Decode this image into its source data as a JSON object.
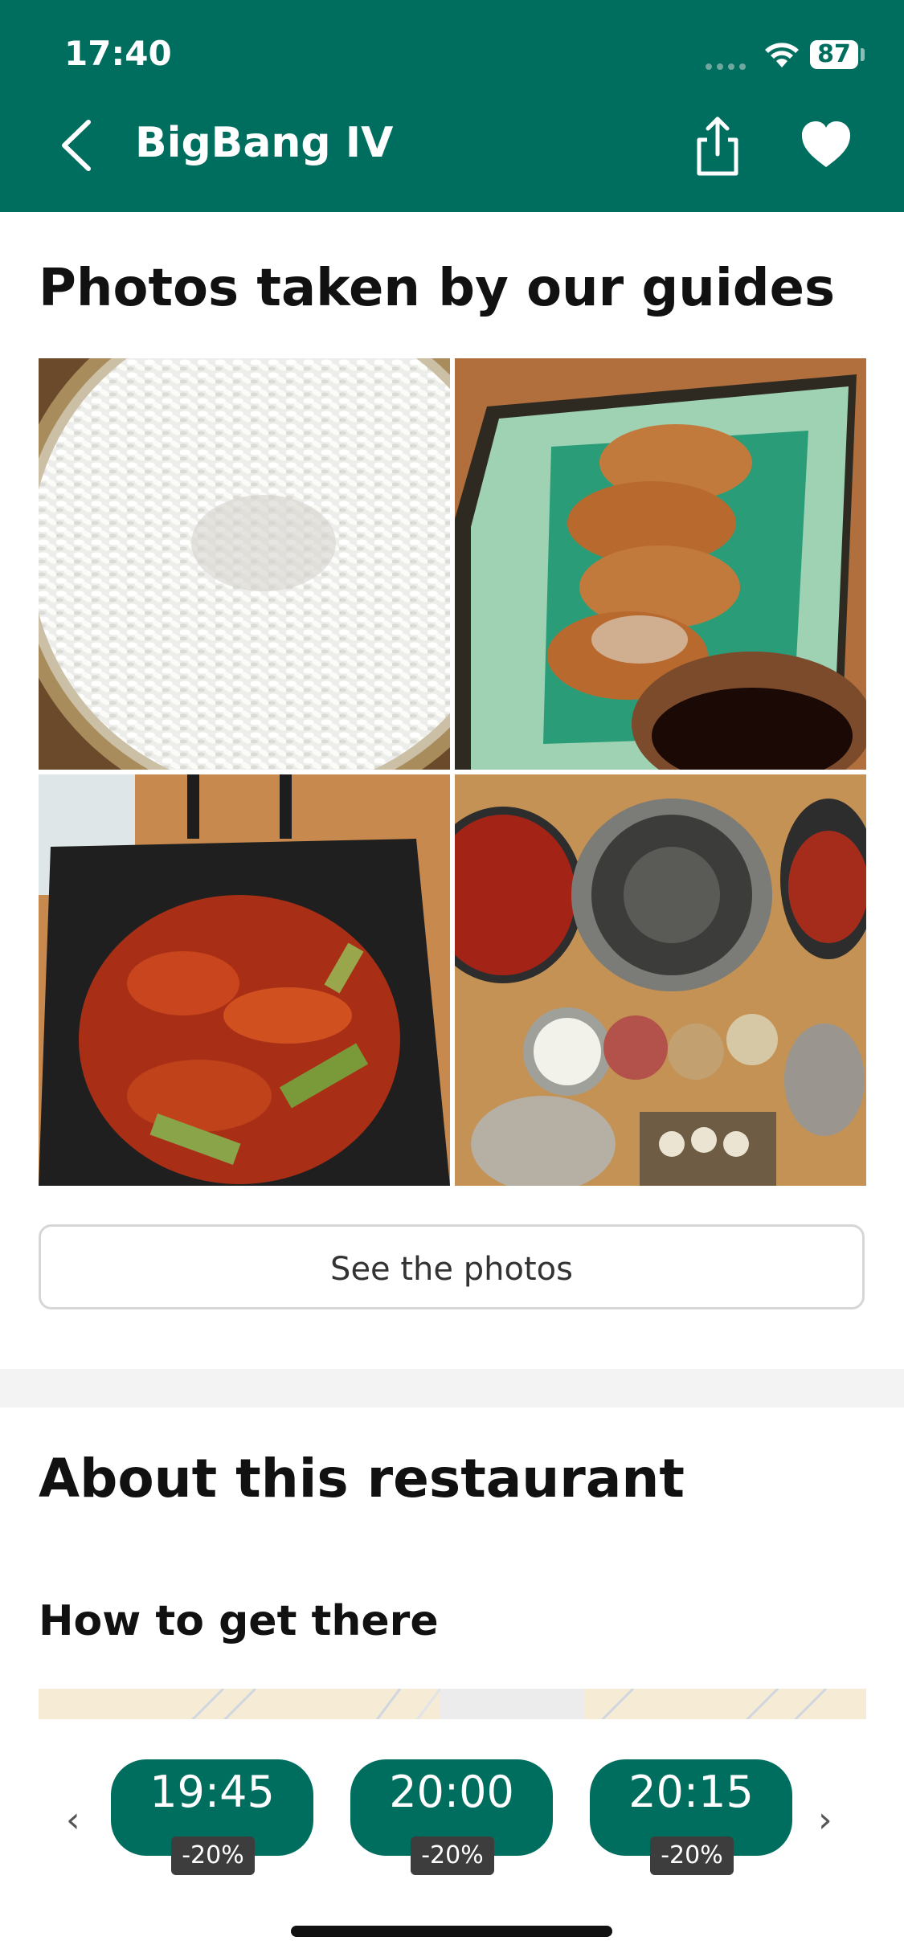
{
  "status_bar": {
    "time": "17:40",
    "battery": "87"
  },
  "header": {
    "title": "BigBang IV"
  },
  "photos_section": {
    "title": "Photos taken by our guides",
    "button_label": "See the photos",
    "photos": [
      "rice-photo",
      "dumplings-photo",
      "spicy-chicken-photo",
      "korean-bbq-table-photo"
    ]
  },
  "about_section": {
    "title": "About this restaurant"
  },
  "directions_section": {
    "title": "How to get there"
  },
  "time_slots": [
    {
      "time": "19:45",
      "discount": "-20%"
    },
    {
      "time": "20:00",
      "discount": "-20%"
    },
    {
      "time": "20:15",
      "discount": "-20%"
    }
  ],
  "colors": {
    "brand": "#006E5F",
    "badge": "#3d3d3d"
  },
  "icons": {
    "back": "chevron-left-icon",
    "share": "share-icon",
    "favorite": "heart-icon",
    "prev": "chevron-left-icon",
    "next": "chevron-right-icon"
  }
}
